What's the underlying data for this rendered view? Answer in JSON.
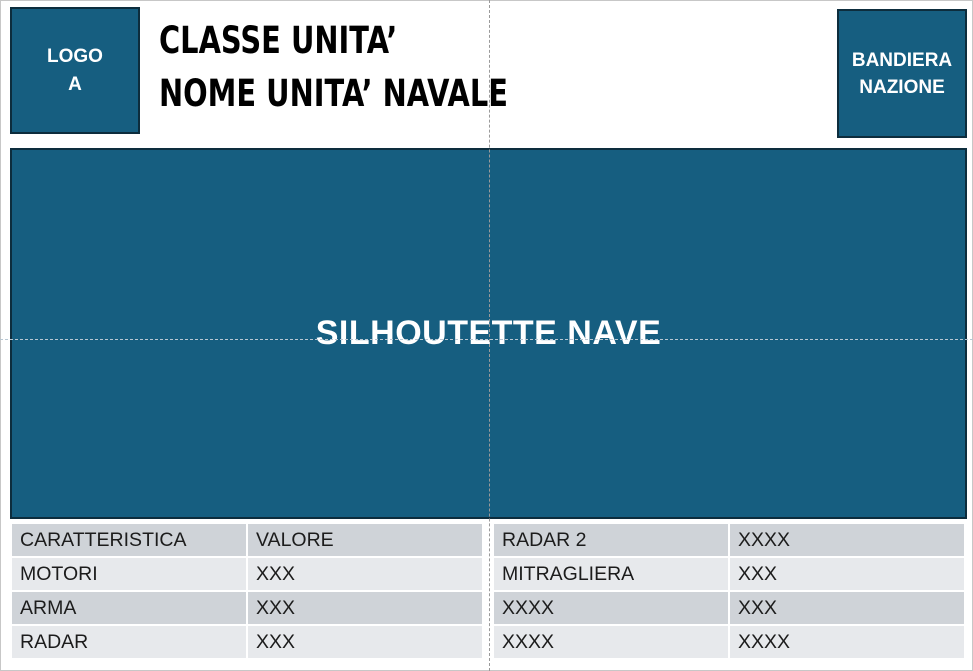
{
  "header": {
    "logo_lines": [
      "LOGO",
      "A"
    ],
    "title_line1": "CLASSE UNITA’",
    "title_line2": "NOME UNITA’ NAVALE",
    "flag_lines": [
      "BANDIERA",
      "NAZIONE"
    ]
  },
  "silhouette_label": "SILHOUTETTE NAVE",
  "colors": {
    "accent": "#165e80",
    "row_dark": "#cfd3d8",
    "row_light": "#e7e9ec"
  },
  "spec_left": [
    [
      "CARATTERISTICA",
      "VALORE"
    ],
    [
      "MOTORI",
      "XXX"
    ],
    [
      "ARMA",
      "XXX"
    ],
    [
      "RADAR",
      "XXX"
    ]
  ],
  "spec_right": [
    [
      "RADAR 2",
      "XXXX"
    ],
    [
      "MITRAGLIERA",
      "XXX"
    ],
    [
      "XXXX",
      "XXX"
    ],
    [
      "XXXX",
      "XXXX"
    ]
  ]
}
